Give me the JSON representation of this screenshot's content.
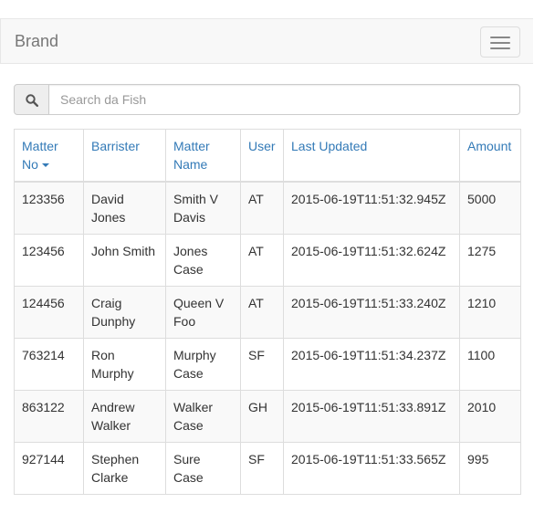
{
  "navbar": {
    "brand": "Brand",
    "toggle_icon": "hamburger-menu-icon"
  },
  "search": {
    "placeholder": "Search da Fish",
    "value": "",
    "icon": "search-icon"
  },
  "table": {
    "headers": [
      "Matter No",
      "Barrister",
      "Matter Name",
      "User",
      "Last Updated",
      "Amount"
    ],
    "sort": {
      "column": "Matter No",
      "direction": "descending",
      "icon": "caret-down-icon"
    },
    "rows": [
      [
        "123356",
        "David Jones",
        "Smith V Davis",
        "AT",
        "2015-06-19T11:51:32.945Z",
        "5000"
      ],
      [
        "123456",
        "John Smith",
        "Jones Case",
        "AT",
        "2015-06-19T11:51:32.624Z",
        "1275"
      ],
      [
        "124456",
        "Craig Dunphy",
        "Queen V Foo",
        "AT",
        "2015-06-19T11:51:33.240Z",
        "1210"
      ],
      [
        "763214",
        "Ron Murphy",
        "Murphy Case",
        "SF",
        "2015-06-19T11:51:34.237Z",
        "1100"
      ],
      [
        "863122",
        "Andrew Walker",
        "Walker Case",
        "GH",
        "2015-06-19T11:51:33.891Z",
        "2010"
      ],
      [
        "927144",
        "Stephen Clarke",
        "Sure Case",
        "SF",
        "2015-06-19T11:51:33.565Z",
        "995"
      ]
    ]
  },
  "colors": {
    "link": "#337ab7",
    "navbar_bg": "#f8f8f8",
    "stripe": "#f9f9f9",
    "border": "#dddddd"
  }
}
